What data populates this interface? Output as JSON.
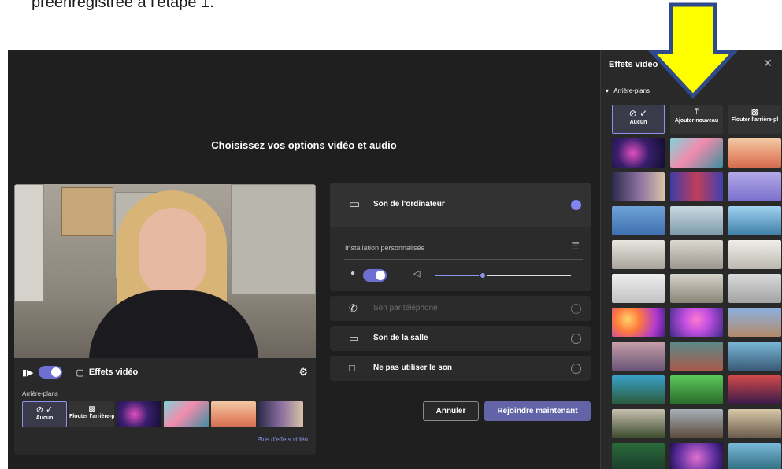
{
  "doc_caption": "préenregistrée à l'étape 1.",
  "main": {
    "title": "Choisissez vos options vidéo et audio"
  },
  "video_panel": {
    "effects_label": "Effets vidéo",
    "backgrounds_label": "Arrière-plans",
    "tiles": [
      {
        "label": "Aucun",
        "selected": true
      },
      {
        "label": "Flouter l'arrière-p"
      },
      {
        "label": ""
      },
      {
        "label": ""
      },
      {
        "label": ""
      },
      {
        "label": ""
      }
    ],
    "more_link": "Plus d'effets vidéo"
  },
  "audio": {
    "computer_sound": "Son de l'ordinateur",
    "custom_setup": "Installation personnalisée",
    "phone_sound": "Son par téléphone",
    "room_sound": "Son de la salle",
    "no_audio": "Ne pas utiliser le son",
    "volume_level": 0.35
  },
  "buttons": {
    "cancel": "Annuler",
    "join": "Rejoindre maintenant"
  },
  "side_panel": {
    "title": "Effets vidéo",
    "section": "Arrière-plans",
    "none_label": "Aucun",
    "add_new_label": "Ajouter nouveau",
    "blur_label": "Flouter l'arrière-pl"
  },
  "colors": {
    "accent": "#6264a7",
    "accent_light": "#7f85f5",
    "arrow": "#ffff00",
    "background": "#1f1f1f"
  }
}
